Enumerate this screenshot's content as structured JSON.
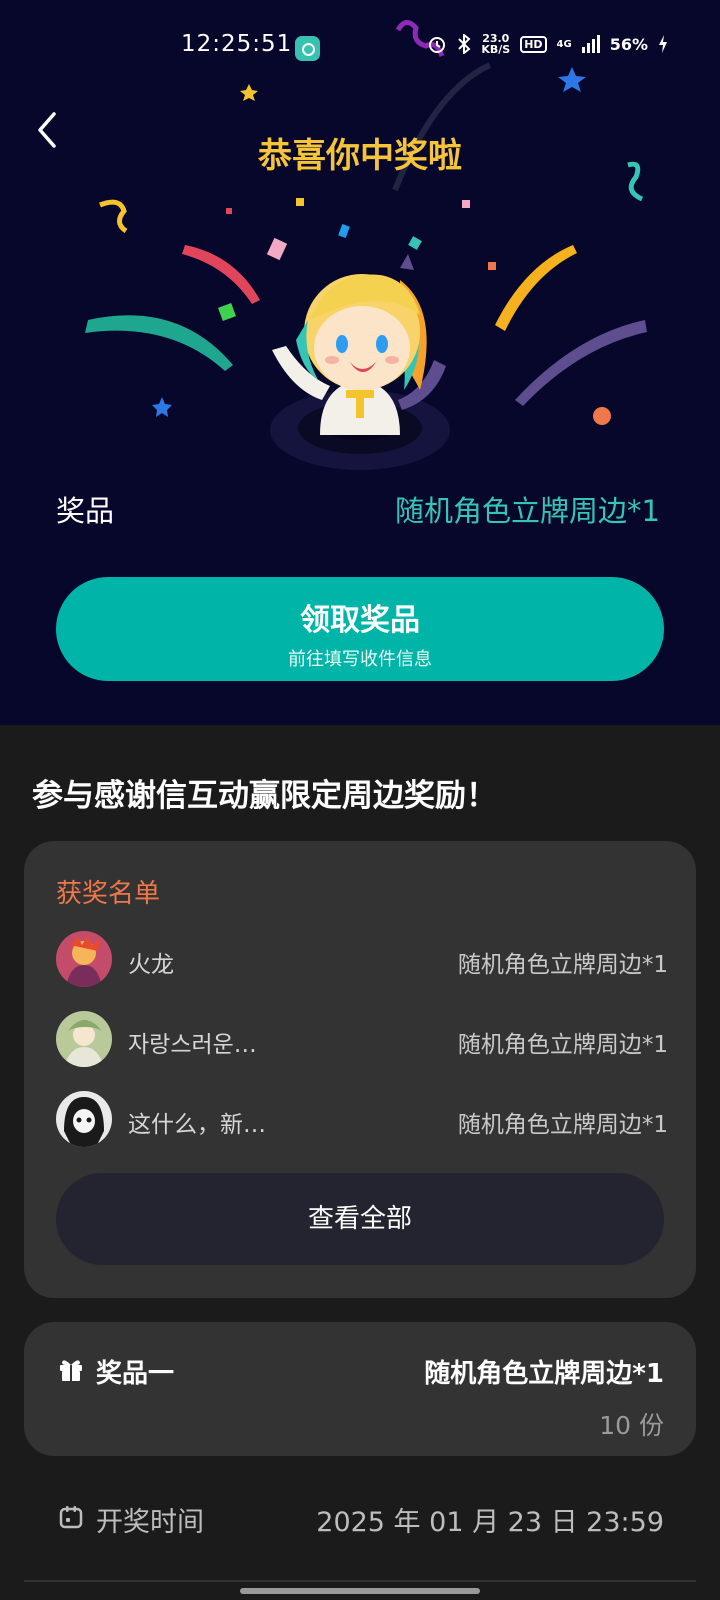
{
  "status_bar": {
    "time": "12:25:51",
    "net_speed_value": "23.0",
    "net_speed_unit": "KB/S",
    "hd_label": "HD",
    "network_type": "4G",
    "battery": "56%"
  },
  "hero": {
    "title": "恭喜你中奖啦",
    "prize_label": "奖品",
    "prize_value": "随机角色立牌周边*1",
    "claim_button_title": "领取奖品",
    "claim_button_subtitle": "前往填写收件信息"
  },
  "section_title": "参与感谢信互动赢限定周边奖励！",
  "winners": {
    "heading": "获奖名单",
    "items": [
      {
        "name": "火龙",
        "prize": "随机角色立牌周边*1"
      },
      {
        "name": "자랑스러운…",
        "prize": "随机角色立牌周边*1"
      },
      {
        "name": "这什么，新…",
        "prize": "随机角色立牌周边*1"
      }
    ],
    "view_all_label": "查看全部"
  },
  "prize_info": {
    "label": "奖品一",
    "value": "随机角色立牌周边*1",
    "quantity": "10 份"
  },
  "draw_time": {
    "label": "开奖时间",
    "value": "2025 年 01 月 23 日 23:59"
  },
  "colors": {
    "hero_bg": "#07062b",
    "title_gold": "#f6c437",
    "accent_teal": "#00b4a7",
    "winners_orange": "#f0774a",
    "card_bg": "#333333"
  },
  "icons": [
    "back-arrow-icon",
    "gift-icon",
    "calendar-icon",
    "alarm-icon",
    "bluetooth-icon",
    "signal-icon",
    "battery-icon"
  ]
}
